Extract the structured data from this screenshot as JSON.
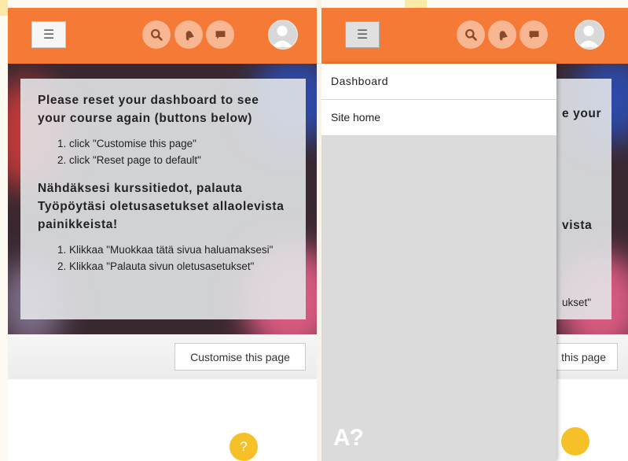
{
  "header": {
    "menu_label": "☰",
    "icons": [
      "search-icon",
      "bell-icon",
      "message-icon",
      "avatar-icon"
    ],
    "accent_color": "#f47a35"
  },
  "notice": {
    "heading_en": "Please reset your dashboard to see your course again (buttons below)",
    "steps_en": [
      "click \"Customise this page\"",
      "click \"Reset page to default\""
    ],
    "heading_fi": "Nähdäksesi kurssitiedot, palauta Työpöytäsi oletusasetukset allaolevista painikkeista!",
    "steps_fi": [
      "Klikkaa \"Muokkaa tätä sivua haluamaksesi\"",
      "Klikkaa \"Palauta sivun oletusasetukset\""
    ]
  },
  "actions": {
    "customise_label": "Customise this page",
    "customise_label_partial": "this page"
  },
  "overlay_fragments": [
    "e your",
    "vista",
    "ukset\""
  ],
  "drawer": {
    "items": [
      "Dashboard",
      "Site home"
    ],
    "logo_text": "A?"
  },
  "help": {
    "label": "?",
    "color": "#f6c128"
  }
}
